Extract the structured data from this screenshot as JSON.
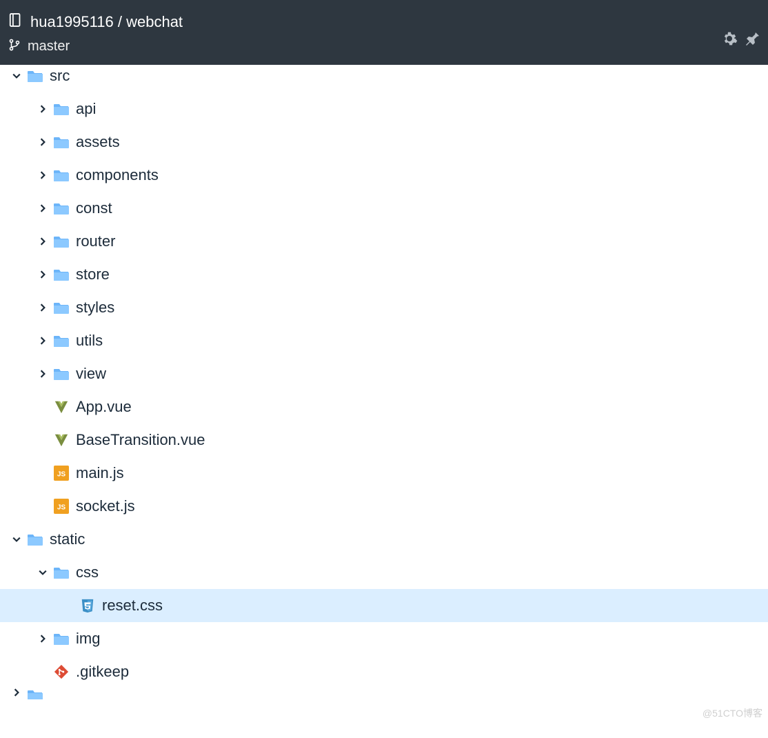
{
  "header": {
    "owner": "hua1995116",
    "repo": "webchat",
    "branch": "master"
  },
  "tree": [
    {
      "depth": 1,
      "kind": "folder",
      "expanded": false,
      "label": "",
      "partial": "top"
    },
    {
      "depth": 0,
      "kind": "folder",
      "expanded": true,
      "label": "src"
    },
    {
      "depth": 1,
      "kind": "folder",
      "expanded": false,
      "label": "api"
    },
    {
      "depth": 1,
      "kind": "folder",
      "expanded": false,
      "label": "assets"
    },
    {
      "depth": 1,
      "kind": "folder",
      "expanded": false,
      "label": "components"
    },
    {
      "depth": 1,
      "kind": "folder",
      "expanded": false,
      "label": "const"
    },
    {
      "depth": 1,
      "kind": "folder",
      "expanded": false,
      "label": "router"
    },
    {
      "depth": 1,
      "kind": "folder",
      "expanded": false,
      "label": "store"
    },
    {
      "depth": 1,
      "kind": "folder",
      "expanded": false,
      "label": "styles"
    },
    {
      "depth": 1,
      "kind": "folder",
      "expanded": false,
      "label": "utils"
    },
    {
      "depth": 1,
      "kind": "folder",
      "expanded": false,
      "label": "view"
    },
    {
      "depth": 1,
      "kind": "vue",
      "label": "App.vue"
    },
    {
      "depth": 1,
      "kind": "vue",
      "label": "BaseTransition.vue"
    },
    {
      "depth": 1,
      "kind": "js",
      "label": "main.js"
    },
    {
      "depth": 1,
      "kind": "js",
      "label": "socket.js"
    },
    {
      "depth": 0,
      "kind": "folder",
      "expanded": true,
      "label": "static"
    },
    {
      "depth": 1,
      "kind": "folder",
      "expanded": true,
      "label": "css"
    },
    {
      "depth": 2,
      "kind": "css",
      "label": "reset.css",
      "selected": true
    },
    {
      "depth": 1,
      "kind": "folder",
      "expanded": false,
      "label": "img"
    },
    {
      "depth": 1,
      "kind": "git",
      "label": ".gitkeep"
    },
    {
      "depth": 0,
      "kind": "folder",
      "expanded": false,
      "label": "",
      "partial": "bottom"
    }
  ],
  "watermark": "@51CTO博客"
}
